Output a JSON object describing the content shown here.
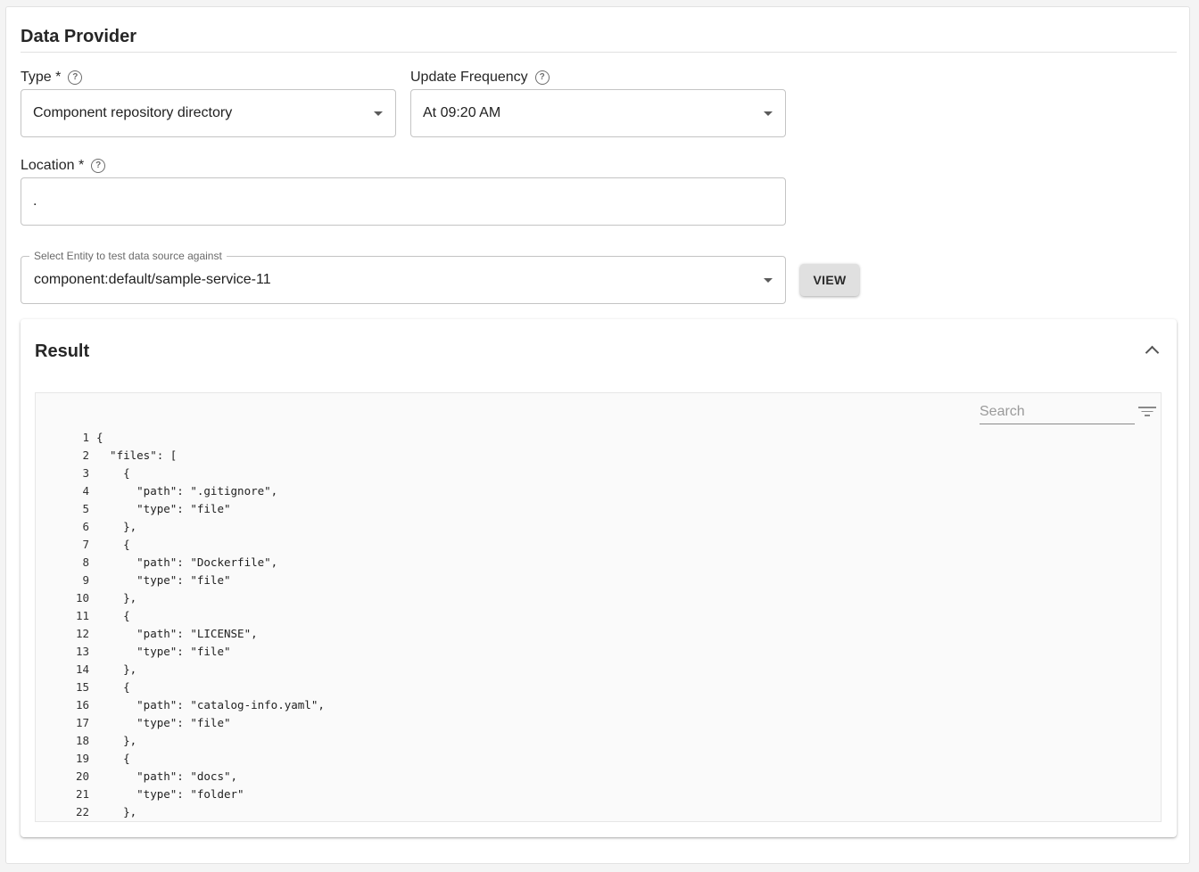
{
  "section": {
    "title": "Data Provider"
  },
  "type_field": {
    "label": "Type *",
    "value": "Component repository directory",
    "help_icon": "help-circle-icon"
  },
  "frequency_field": {
    "label": "Update Frequency",
    "value": "At 09:20 AM",
    "help_icon": "help-circle-icon"
  },
  "location_field": {
    "label": "Location *",
    "value": ".",
    "help_icon": "help-circle-icon"
  },
  "entity_field": {
    "legend": "Select Entity to test data source against",
    "value": "component:default/sample-service-11"
  },
  "view_button": {
    "label": "VIEW"
  },
  "result": {
    "title": "Result",
    "collapse_icon": "chevron-up-icon",
    "search_placeholder": "Search",
    "filter_icon": "filter-icon",
    "lines": [
      {
        "no": "1",
        "text": "{"
      },
      {
        "no": "2",
        "text": "  \"files\": ["
      },
      {
        "no": "3",
        "text": "    {"
      },
      {
        "no": "4",
        "text": "      \"path\": \".gitignore\","
      },
      {
        "no": "5",
        "text": "      \"type\": \"file\""
      },
      {
        "no": "6",
        "text": "    },"
      },
      {
        "no": "7",
        "text": "    {"
      },
      {
        "no": "8",
        "text": "      \"path\": \"Dockerfile\","
      },
      {
        "no": "9",
        "text": "      \"type\": \"file\""
      },
      {
        "no": "10",
        "text": "    },"
      },
      {
        "no": "11",
        "text": "    {"
      },
      {
        "no": "12",
        "text": "      \"path\": \"LICENSE\","
      },
      {
        "no": "13",
        "text": "      \"type\": \"file\""
      },
      {
        "no": "14",
        "text": "    },"
      },
      {
        "no": "15",
        "text": "    {"
      },
      {
        "no": "16",
        "text": "      \"path\": \"catalog-info.yaml\","
      },
      {
        "no": "17",
        "text": "      \"type\": \"file\""
      },
      {
        "no": "18",
        "text": "    },"
      },
      {
        "no": "19",
        "text": "    {"
      },
      {
        "no": "20",
        "text": "      \"path\": \"docs\","
      },
      {
        "no": "21",
        "text": "      \"type\": \"folder\""
      },
      {
        "no": "22",
        "text": "    },"
      }
    ]
  }
}
